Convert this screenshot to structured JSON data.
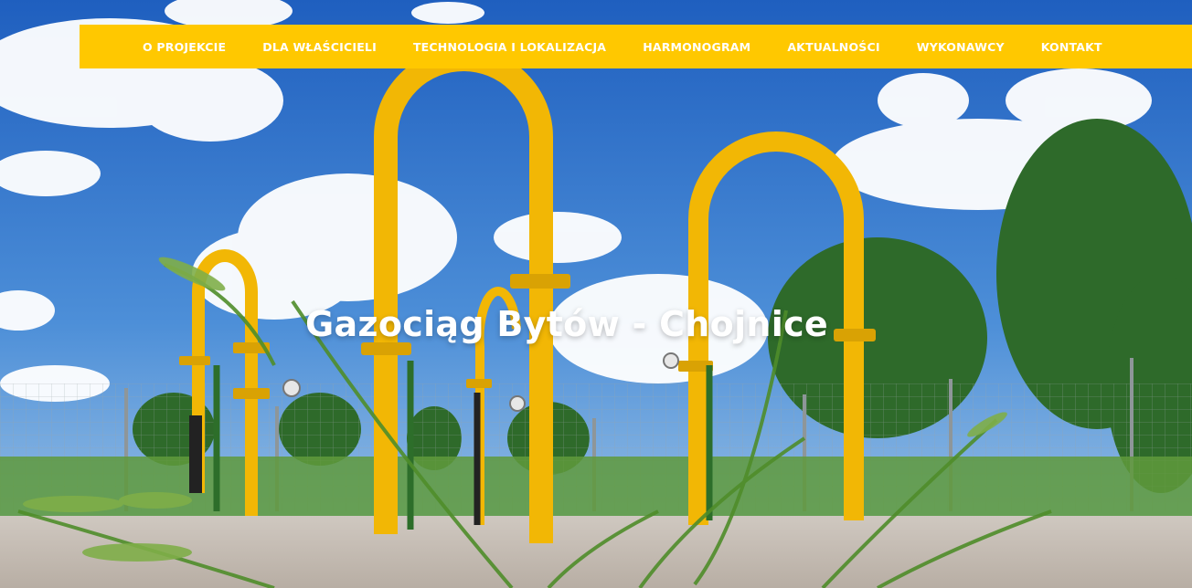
{
  "colors": {
    "nav_background": "#FFC800",
    "nav_text": "#FFFFFF",
    "title_text": "#FFFFFF",
    "pipe_yellow": "#F2B705"
  },
  "nav": {
    "items": [
      {
        "label": "O PROJEKCIE"
      },
      {
        "label": "DLA WŁAŚCICIELI"
      },
      {
        "label": "TECHNOLOGIA I LOKALIZACJA"
      },
      {
        "label": "HARMONOGRAM"
      },
      {
        "label": "AKTUALNOŚCI"
      },
      {
        "label": "WYKONAWCY"
      },
      {
        "label": "KONTAKT"
      }
    ]
  },
  "hero": {
    "title": "Gazociąg Bytów - Chojnice",
    "image_subject": "gas-pipeline-valve-station-photo"
  }
}
